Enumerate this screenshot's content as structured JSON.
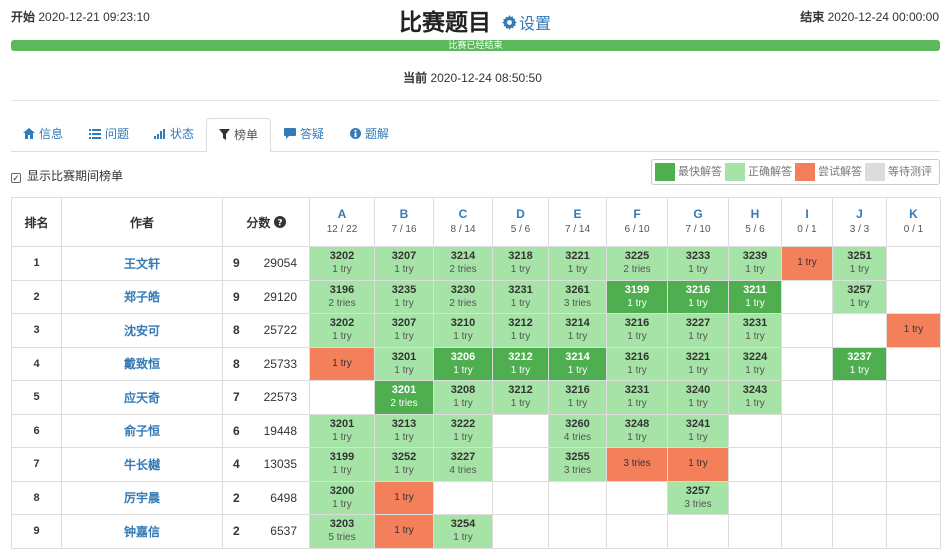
{
  "header": {
    "start_label": "开始",
    "start_time": "2020-12-21 09:23:10",
    "title": "比赛题目",
    "settings_label": "设置",
    "end_label": "结束",
    "end_time": "2020-12-24 00:00:00",
    "progress_text": "比赛已经结束",
    "progress_fraction": 1.0,
    "current_label": "当前",
    "current_time": "2020-12-24 08:50:50"
  },
  "tabs": [
    {
      "label": "信息",
      "icon": "home-icon"
    },
    {
      "label": "问题",
      "icon": "list-icon"
    },
    {
      "label": "状态",
      "icon": "bar-chart-icon"
    },
    {
      "label": "榜单",
      "icon": "filter-icon",
      "active": true
    },
    {
      "label": "答疑",
      "icon": "comment-icon"
    },
    {
      "label": "题解",
      "icon": "info-icon"
    }
  ],
  "options": {
    "show_during_contest_label": "显示比赛期间榜单",
    "checked": true
  },
  "legend": [
    {
      "label": "最快解答",
      "color": "#4fae4f"
    },
    {
      "label": "正确解答",
      "color": "#a6e3a6"
    },
    {
      "label": "尝试解答",
      "color": "#f47f5b"
    },
    {
      "label": "等待测评",
      "color": "#dcdcdc"
    }
  ],
  "table": {
    "col_rank": "排名",
    "col_author": "作者",
    "col_score": "分数",
    "problems": [
      {
        "letter": "A",
        "stat": "12 / 22"
      },
      {
        "letter": "B",
        "stat": "7 / 16"
      },
      {
        "letter": "C",
        "stat": "8 / 14"
      },
      {
        "letter": "D",
        "stat": "5 / 6"
      },
      {
        "letter": "E",
        "stat": "7 / 14"
      },
      {
        "letter": "F",
        "stat": "6 / 10"
      },
      {
        "letter": "G",
        "stat": "7 / 10"
      },
      {
        "letter": "H",
        "stat": "5 / 6"
      },
      {
        "letter": "I",
        "stat": "0 / 1"
      },
      {
        "letter": "J",
        "stat": "3 / 3"
      },
      {
        "letter": "K",
        "stat": "0 / 1"
      }
    ],
    "rows": [
      {
        "rank": "1",
        "name": "王文轩",
        "solved": "9",
        "penalty": "29054",
        "cells": [
          {
            "s": "ac",
            "id": "3202",
            "t": "1 try"
          },
          {
            "s": "ac",
            "id": "3207",
            "t": "1 try"
          },
          {
            "s": "ac",
            "id": "3214",
            "t": "2 tries"
          },
          {
            "s": "ac",
            "id": "3218",
            "t": "1 try"
          },
          {
            "s": "ac",
            "id": "3221",
            "t": "1 try"
          },
          {
            "s": "ac",
            "id": "3225",
            "t": "2 tries"
          },
          {
            "s": "ac",
            "id": "3233",
            "t": "1 try"
          },
          {
            "s": "ac",
            "id": "3239",
            "t": "1 try"
          },
          {
            "s": "wa",
            "id": "",
            "t": "1 try"
          },
          {
            "s": "ac",
            "id": "3251",
            "t": "1 try"
          },
          {
            "s": "",
            "id": "",
            "t": ""
          }
        ]
      },
      {
        "rank": "2",
        "name": "郑子皓",
        "solved": "9",
        "penalty": "29120",
        "cells": [
          {
            "s": "ac",
            "id": "3196",
            "t": "2 tries"
          },
          {
            "s": "ac",
            "id": "3235",
            "t": "1 try"
          },
          {
            "s": "ac",
            "id": "3230",
            "t": "2 tries"
          },
          {
            "s": "ac",
            "id": "3231",
            "t": "1 try"
          },
          {
            "s": "ac",
            "id": "3261",
            "t": "3 tries"
          },
          {
            "s": "fb",
            "id": "3199",
            "t": "1 try"
          },
          {
            "s": "fb",
            "id": "3216",
            "t": "1 try"
          },
          {
            "s": "fb",
            "id": "3211",
            "t": "1 try"
          },
          {
            "s": "",
            "id": "",
            "t": ""
          },
          {
            "s": "ac",
            "id": "3257",
            "t": "1 try"
          },
          {
            "s": "",
            "id": "",
            "t": ""
          }
        ]
      },
      {
        "rank": "3",
        "name": "沈安可",
        "solved": "8",
        "penalty": "25722",
        "cells": [
          {
            "s": "ac",
            "id": "3202",
            "t": "1 try"
          },
          {
            "s": "ac",
            "id": "3207",
            "t": "1 try"
          },
          {
            "s": "ac",
            "id": "3210",
            "t": "1 try"
          },
          {
            "s": "ac",
            "id": "3212",
            "t": "1 try"
          },
          {
            "s": "ac",
            "id": "3214",
            "t": "1 try"
          },
          {
            "s": "ac",
            "id": "3216",
            "t": "1 try"
          },
          {
            "s": "ac",
            "id": "3227",
            "t": "1 try"
          },
          {
            "s": "ac",
            "id": "3231",
            "t": "1 try"
          },
          {
            "s": "",
            "id": "",
            "t": ""
          },
          {
            "s": "",
            "id": "",
            "t": ""
          },
          {
            "s": "wa",
            "id": "",
            "t": "1 try"
          }
        ]
      },
      {
        "rank": "4",
        "name": "戴致恒",
        "solved": "8",
        "penalty": "25733",
        "cells": [
          {
            "s": "wa",
            "id": "",
            "t": "1 try"
          },
          {
            "s": "ac",
            "id": "3201",
            "t": "1 try"
          },
          {
            "s": "fb",
            "id": "3206",
            "t": "1 try"
          },
          {
            "s": "fb",
            "id": "3212",
            "t": "1 try"
          },
          {
            "s": "fb",
            "id": "3214",
            "t": "1 try"
          },
          {
            "s": "ac",
            "id": "3216",
            "t": "1 try"
          },
          {
            "s": "ac",
            "id": "3221",
            "t": "1 try"
          },
          {
            "s": "ac",
            "id": "3224",
            "t": "1 try"
          },
          {
            "s": "",
            "id": "",
            "t": ""
          },
          {
            "s": "fb",
            "id": "3237",
            "t": "1 try"
          },
          {
            "s": "",
            "id": "",
            "t": ""
          }
        ]
      },
      {
        "rank": "5",
        "name": "应天奇",
        "solved": "7",
        "penalty": "22573",
        "cells": [
          {
            "s": "",
            "id": "",
            "t": ""
          },
          {
            "s": "fb",
            "id": "3201",
            "t": "2 tries"
          },
          {
            "s": "ac",
            "id": "3208",
            "t": "1 try"
          },
          {
            "s": "ac",
            "id": "3212",
            "t": "1 try"
          },
          {
            "s": "ac",
            "id": "3216",
            "t": "1 try"
          },
          {
            "s": "ac",
            "id": "3231",
            "t": "1 try"
          },
          {
            "s": "ac",
            "id": "3240",
            "t": "1 try"
          },
          {
            "s": "ac",
            "id": "3243",
            "t": "1 try"
          },
          {
            "s": "",
            "id": "",
            "t": ""
          },
          {
            "s": "",
            "id": "",
            "t": ""
          },
          {
            "s": "",
            "id": "",
            "t": ""
          }
        ]
      },
      {
        "rank": "6",
        "name": "俞子恒",
        "solved": "6",
        "penalty": "19448",
        "cells": [
          {
            "s": "ac",
            "id": "3201",
            "t": "1 try"
          },
          {
            "s": "ac",
            "id": "3213",
            "t": "1 try"
          },
          {
            "s": "ac",
            "id": "3222",
            "t": "1 try"
          },
          {
            "s": "",
            "id": "",
            "t": ""
          },
          {
            "s": "ac",
            "id": "3260",
            "t": "4 tries"
          },
          {
            "s": "ac",
            "id": "3248",
            "t": "1 try"
          },
          {
            "s": "ac",
            "id": "3241",
            "t": "1 try"
          },
          {
            "s": "",
            "id": "",
            "t": ""
          },
          {
            "s": "",
            "id": "",
            "t": ""
          },
          {
            "s": "",
            "id": "",
            "t": ""
          },
          {
            "s": "",
            "id": "",
            "t": ""
          }
        ]
      },
      {
        "rank": "7",
        "name": "牛长樾",
        "solved": "4",
        "penalty": "13035",
        "cells": [
          {
            "s": "ac",
            "id": "3199",
            "t": "1 try"
          },
          {
            "s": "ac",
            "id": "3252",
            "t": "1 try"
          },
          {
            "s": "ac",
            "id": "3227",
            "t": "4 tries"
          },
          {
            "s": "",
            "id": "",
            "t": ""
          },
          {
            "s": "ac",
            "id": "3255",
            "t": "3 tries"
          },
          {
            "s": "wa",
            "id": "",
            "t": "3 tries"
          },
          {
            "s": "wa",
            "id": "",
            "t": "1 try"
          },
          {
            "s": "",
            "id": "",
            "t": ""
          },
          {
            "s": "",
            "id": "",
            "t": ""
          },
          {
            "s": "",
            "id": "",
            "t": ""
          },
          {
            "s": "",
            "id": "",
            "t": ""
          }
        ]
      },
      {
        "rank": "8",
        "name": "厉宇晨",
        "solved": "2",
        "penalty": "6498",
        "cells": [
          {
            "s": "ac",
            "id": "3200",
            "t": "1 try"
          },
          {
            "s": "wa",
            "id": "",
            "t": "1 try"
          },
          {
            "s": "",
            "id": "",
            "t": ""
          },
          {
            "s": "",
            "id": "",
            "t": ""
          },
          {
            "s": "",
            "id": "",
            "t": ""
          },
          {
            "s": "",
            "id": "",
            "t": ""
          },
          {
            "s": "ac",
            "id": "3257",
            "t": "3 tries"
          },
          {
            "s": "",
            "id": "",
            "t": ""
          },
          {
            "s": "",
            "id": "",
            "t": ""
          },
          {
            "s": "",
            "id": "",
            "t": ""
          },
          {
            "s": "",
            "id": "",
            "t": ""
          }
        ]
      },
      {
        "rank": "9",
        "name": "钟嘉信",
        "solved": "2",
        "penalty": "6537",
        "cells": [
          {
            "s": "ac",
            "id": "3203",
            "t": "5 tries"
          },
          {
            "s": "wa",
            "id": "",
            "t": "1 try"
          },
          {
            "s": "ac",
            "id": "3254",
            "t": "1 try"
          },
          {
            "s": "",
            "id": "",
            "t": ""
          },
          {
            "s": "",
            "id": "",
            "t": ""
          },
          {
            "s": "",
            "id": "",
            "t": ""
          },
          {
            "s": "",
            "id": "",
            "t": ""
          },
          {
            "s": "",
            "id": "",
            "t": ""
          },
          {
            "s": "",
            "id": "",
            "t": ""
          },
          {
            "s": "",
            "id": "",
            "t": ""
          },
          {
            "s": "",
            "id": "",
            "t": ""
          }
        ]
      }
    ]
  }
}
